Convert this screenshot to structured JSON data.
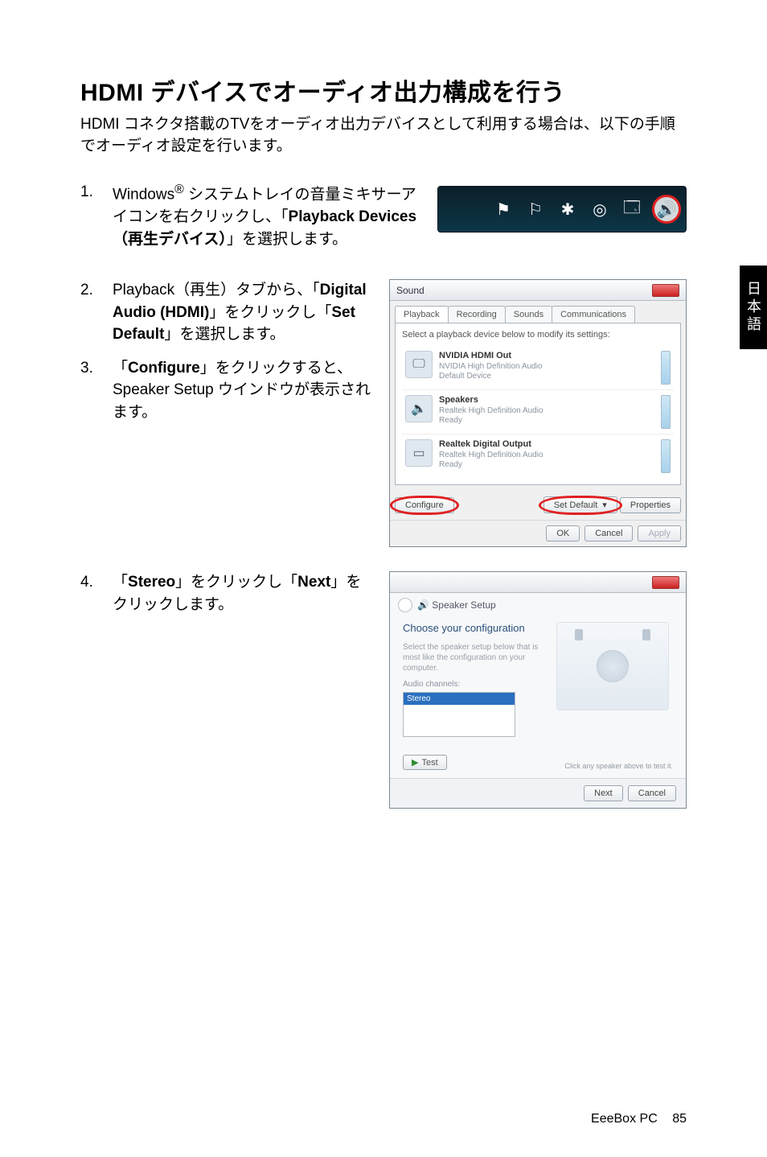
{
  "page": {
    "footer_text": "EeeBox PC",
    "page_number": "85",
    "side_tab": "日本語"
  },
  "heading": "HDMI デバイスでオーディオ出力構成を行う",
  "intro": "HDMI コネクタ搭載のTVをオーディオ出力デバイスとして利用する場合は、以下の手順でオーディオ設定を行います。",
  "steps": {
    "s1": {
      "num": "1.",
      "pre": "Windows",
      "reg": "®",
      "post_a": " システムトレイの音量ミキサーアイコンを右クリックし、「",
      "bold": "Playback Devices（再生デバイス）",
      "post_b": "」を選択します。"
    },
    "s2": {
      "num": "2.",
      "pre": "Playback（再生）タブから、「",
      "bold1": "Digital Audio (HDMI)",
      "mid": "」をクリックし「",
      "bold2": "Set Default",
      "post": "」を選択します。"
    },
    "s3": {
      "num": "3.",
      "pre": " 「",
      "bold": "Configure",
      "post": "」をクリックすると、Speaker Setup ウインドウが表示されます。"
    },
    "s4": {
      "num": "4.",
      "pre": " 「",
      "bold1": "Stereo",
      "mid": "」をクリックし「",
      "bold2": "Next",
      "post": "」をクリックします。"
    }
  },
  "sound_dialog": {
    "title": "Sound",
    "tabs": {
      "playback": "Playback",
      "recording": "Recording",
      "sounds": "Sounds",
      "communications": "Communications"
    },
    "hint": "Select a playback device below to modify its settings:",
    "devices": [
      {
        "name": "NVIDIA HDMI Out",
        "desc": "NVIDIA High Definition Audio",
        "status": "Default Device"
      },
      {
        "name": "Speakers",
        "desc": "Realtek High Definition Audio",
        "status": "Ready"
      },
      {
        "name": "Realtek Digital Output",
        "desc": "Realtek High Definition Audio",
        "status": "Ready"
      }
    ],
    "buttons": {
      "configure": "Configure",
      "set_default": "Set Default",
      "properties": "Properties",
      "ok": "OK",
      "cancel": "Cancel",
      "apply": "Apply"
    }
  },
  "speaker_setup": {
    "title": "Speaker Setup",
    "section": "Choose your configuration",
    "hint": "Select the speaker setup below that is most like the configuration on your computer.",
    "label": "Audio channels:",
    "selected": "Stereo",
    "test": "Test",
    "right_hint": "Click any speaker above to test it.",
    "next": "Next",
    "cancel": "Cancel"
  },
  "tray_icons": {
    "a": "flag-icon",
    "b": "action-center-icon",
    "c": "bluetooth-icon",
    "d": "network-icon",
    "e": "power-icon",
    "f": "volume-icon"
  }
}
